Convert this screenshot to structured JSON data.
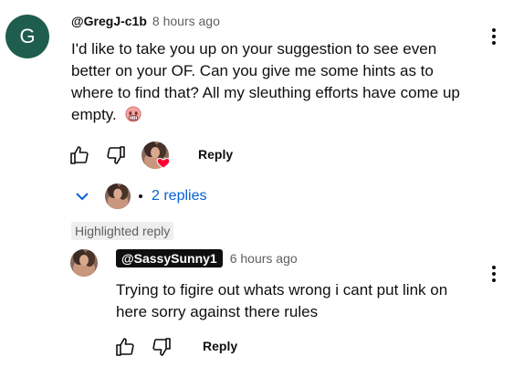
{
  "comment": {
    "avatar_letter": "G",
    "author": "@GregJ-c1b",
    "time": "8 hours ago",
    "text": "I'd like to take you up on your suggestion to see even better on your OF. Can you give me some hints as to where to find that? All my sleuthing efforts have come up empty.",
    "emoji": "disappointed-face-emoji",
    "reply_label": "Reply",
    "avatar_color": "#1f5d4e"
  },
  "replies_toggle": {
    "label": "2 replies",
    "color": "#065fd4"
  },
  "highlighted_label": "Highlighted reply",
  "reply": {
    "author": "@SassySunny1",
    "time": "6 hours ago",
    "text": "Trying to figire out whats wrong i cant put link on here sorry against there rules",
    "reply_label": "Reply"
  },
  "icons": {
    "like": "thumbs-up-icon",
    "dislike": "thumbs-down-icon",
    "more": "more-vertical-icon",
    "expand": "chevron-down-icon",
    "heart": "heart-icon"
  }
}
